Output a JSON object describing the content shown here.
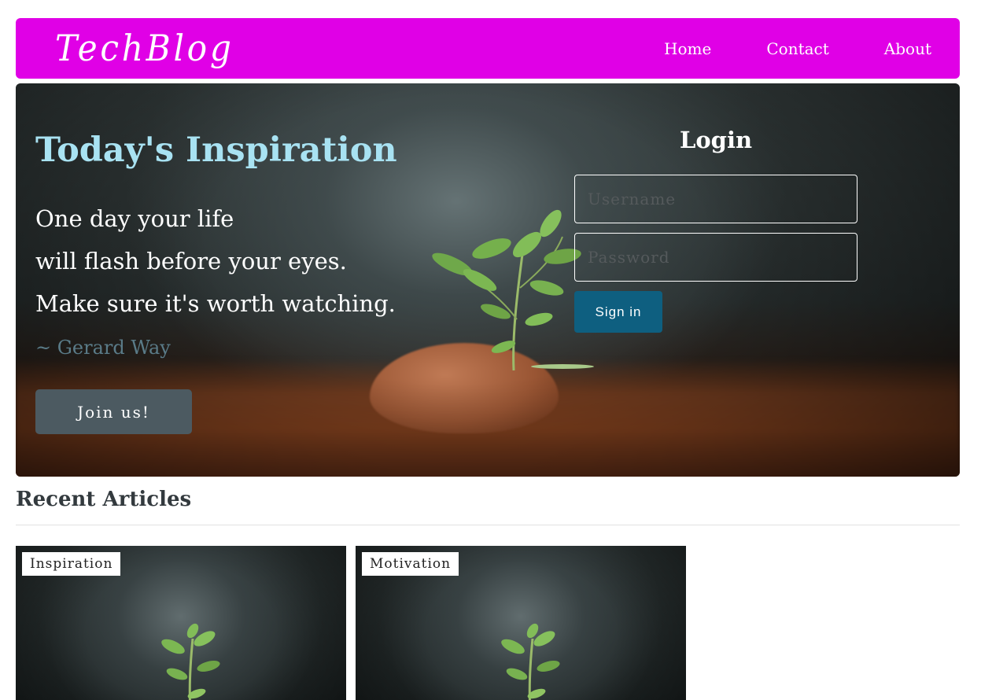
{
  "navbar": {
    "brand": "TechBlog",
    "links": [
      "Home",
      "Contact",
      "About"
    ]
  },
  "hero": {
    "title": "Today's Inspiration",
    "quote_lines": [
      "One day your life",
      "will flash before your eyes.",
      "Make sure it's worth watching."
    ],
    "author": "~ Gerard Way",
    "join_button": "Join us!"
  },
  "login": {
    "title": "Login",
    "username_placeholder": "Username",
    "password_placeholder": "Password",
    "signin_button": "Sign in"
  },
  "articles": {
    "section_title": "Recent Articles",
    "cards": [
      {
        "tag": "Inspiration",
        "image": "sprout-photo"
      },
      {
        "tag": "Motivation",
        "image": "sprout-photo"
      }
    ]
  },
  "colors": {
    "navbar_bg": "#e000e6",
    "hero_title": "#a8e2f2",
    "author": "#5a7b88",
    "join_button_bg": "#4c5a61",
    "signin_button_bg": "#0e5f80"
  }
}
